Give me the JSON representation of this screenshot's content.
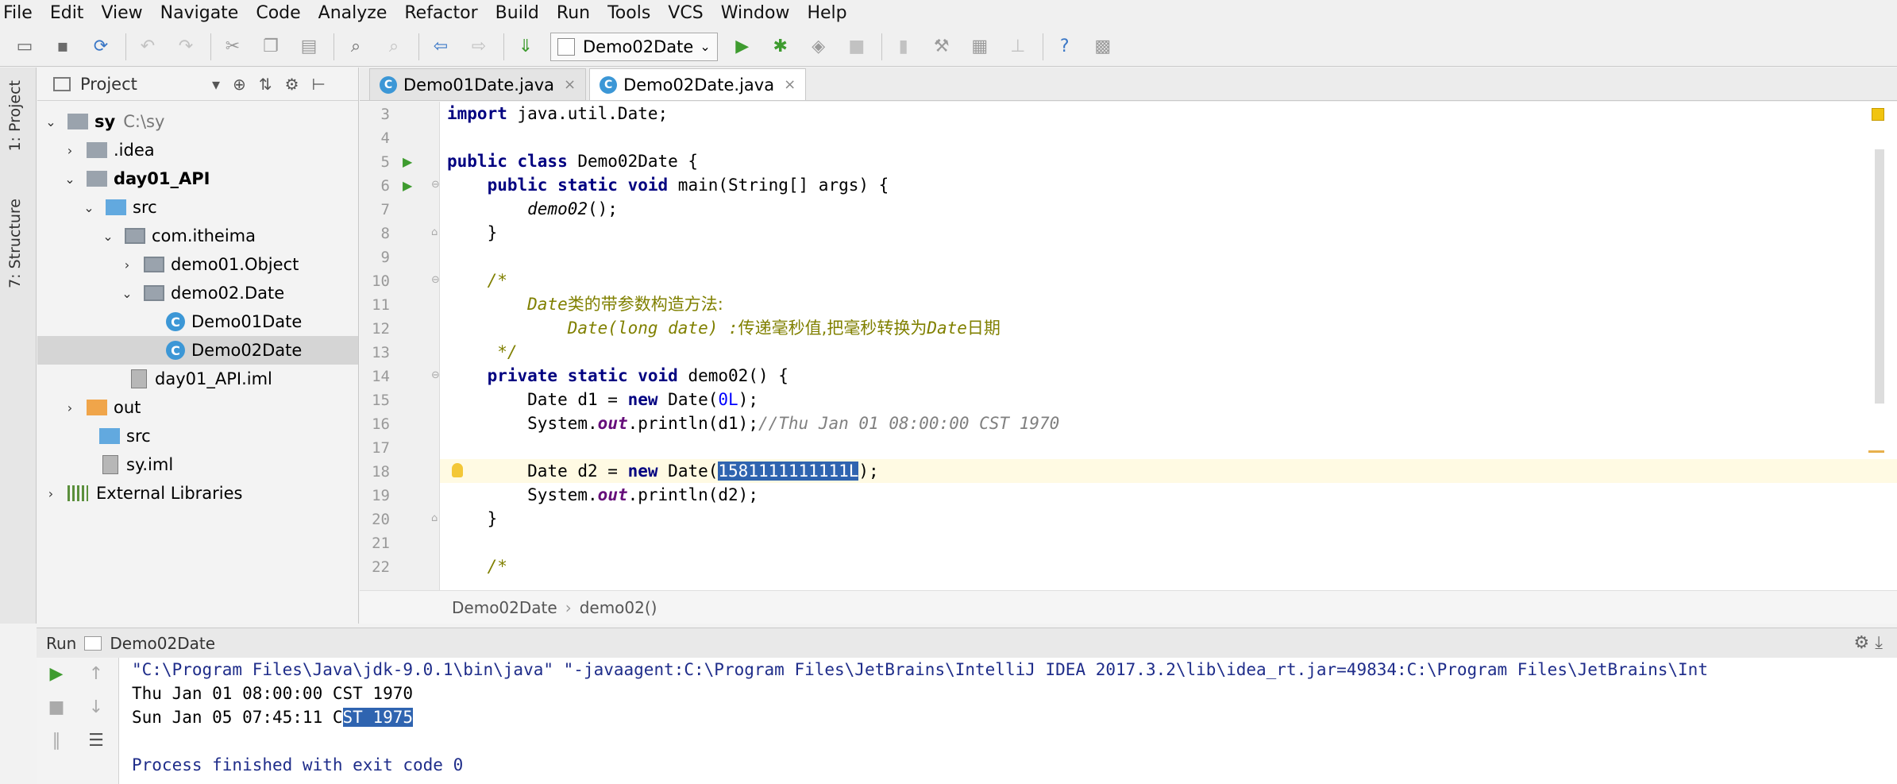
{
  "menu": [
    "File",
    "Edit",
    "View",
    "Navigate",
    "Code",
    "Analyze",
    "Refactor",
    "Build",
    "Run",
    "Tools",
    "VCS",
    "Window",
    "Help"
  ],
  "toolbar": {
    "run_config": "Demo02Date"
  },
  "side_tabs": {
    "project": "1: Project",
    "structure": "7: Structure"
  },
  "project": {
    "title": "Project",
    "tree": [
      {
        "label": "sy",
        "hint": "C:\\sy"
      },
      {
        "label": ".idea"
      },
      {
        "label": "day01_API"
      },
      {
        "label": "src"
      },
      {
        "label": "com.itheima"
      },
      {
        "label": "demo01.Object"
      },
      {
        "label": "demo02.Date"
      },
      {
        "label": "Demo01Date"
      },
      {
        "label": "Demo02Date"
      },
      {
        "label": "day01_API.iml"
      },
      {
        "label": "out"
      },
      {
        "label": "src"
      },
      {
        "label": "sy.iml"
      },
      {
        "label": "External Libraries"
      }
    ]
  },
  "tabs": [
    {
      "label": "Demo01Date.java"
    },
    {
      "label": "Demo02Date.java"
    }
  ],
  "editor": {
    "line_numbers": [
      "3",
      "4",
      "5",
      "6",
      "7",
      "8",
      "9",
      "10",
      "11",
      "12",
      "13",
      "14",
      "15",
      "16",
      "17",
      "18",
      "19",
      "20",
      "21",
      "22"
    ],
    "lines": {
      "l3": {
        "kw": "import",
        "rest": " java.util.Date;"
      },
      "l5": {
        "kw": "public class",
        "rest": " Demo02Date {"
      },
      "l6": {
        "indent": "    ",
        "kw": "public static void",
        "rest": " main(String[] args) {"
      },
      "l7": {
        "indent": "        ",
        "call": "demo02",
        "rest": "();"
      },
      "l8": {
        "text": "    }"
      },
      "l10": {
        "text": "    /*"
      },
      "l11": {
        "indent": "        ",
        "a": "Date",
        "b": "类的带参数构造方法:"
      },
      "l12": {
        "indent": "            ",
        "a": "Date(long date) :",
        "b": "传递毫秒值,把毫秒转换为",
        "c": "Date",
        "d": "日期"
      },
      "l13": {
        "text": "     */"
      },
      "l14": {
        "indent": "    ",
        "kw": "private static void",
        "rest": " demo02() {"
      },
      "l15": {
        "indent": "        ",
        "pre": "Date d1 = ",
        "kw": "new",
        "mid": " Date(",
        "num": "0L",
        "post": ");"
      },
      "l16": {
        "indent": "        ",
        "pre": "System.",
        "field": "out",
        "mid": ".println(d1);",
        "comment": "//Thu Jan 01 08:00:00 CST 1970"
      },
      "l18": {
        "indent": "        ",
        "pre": "Date d2 = ",
        "kw": "new",
        "mid": " Date(",
        "sel": "1581111111111L",
        "post": ");"
      },
      "l19": {
        "indent": "        ",
        "pre": "System.",
        "field": "out",
        "mid": ".println(d2);"
      },
      "l20": {
        "text": "    }"
      },
      "l22": {
        "text": "    /*"
      }
    }
  },
  "breadcrumb": [
    "Demo02Date",
    "demo02()"
  ],
  "run": {
    "label": "Run",
    "config": "Demo02Date",
    "console": {
      "cmd": "\"C:\\Program Files\\Java\\jdk-9.0.1\\bin\\java\" \"-javaagent:C:\\Program Files\\JetBrains\\IntelliJ IDEA 2017.3.2\\lib\\idea_rt.jar=49834:C:\\Program Files\\JetBrains\\Int",
      "out1": "Thu Jan 01 08:00:00 CST 1970",
      "out2_pre": "Sun Jan 05 07:45:11 C",
      "out2_sel": "ST 1975",
      "exit": "Process finished with exit code 0"
    }
  },
  "colors": {
    "keyword": "#000080",
    "comment": "#808080",
    "doc_comment": "#808000",
    "number": "#0000ff",
    "selection": "#2f64b0",
    "current_line": "#fffae3",
    "run_green": "#3e9b2f"
  }
}
